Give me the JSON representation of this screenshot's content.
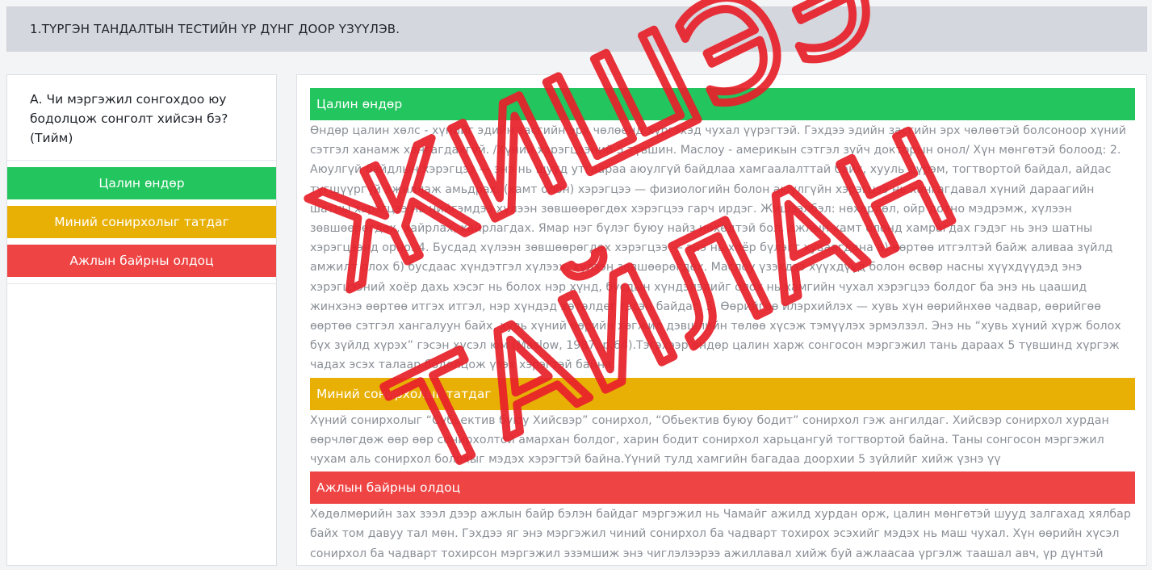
{
  "header": {
    "title": "1.ТҮРГЭН ТАНДАЛТЫН ТЕСТИЙН ҮР ДҮНГ ДООР ҮЗҮҮЛЭВ."
  },
  "question": {
    "text": "А. Чи мэргэжил сонгохдоо юу бодолцож сонголт хийсэн бэ? (Тийм)"
  },
  "options": [
    {
      "label": "Цалин өндөр",
      "color": "#22c55e"
    },
    {
      "label": "Миний сонирхолыг татдаг",
      "color": "#e8b005"
    },
    {
      "label": "Ажлын байрны олдоц",
      "color": "#ef4444"
    }
  ],
  "sections": [
    {
      "title": "Цалин өндөр",
      "color": "#22c55e",
      "text": "Өндөр цалин хөлс - хүнийг эдийн засгийн эрх чөлөөнд хүргэхэд чухал үүрэгтэй. Гэхдээ эдийн засгийн эрх чөлөөтэй болсоноор хүний сэтгэл ханамж хангагдахгүй. /Хүний хэрэгцээний 5 түвшин. Маслоу - америкын сэтгэл зүйч докторын онол/ Хүн мөнгөтэй болоод: 2. Аюулгүй байдлын хэрэгцээ — энэ нь шууд утгаараа аюулгүй байдлаа хамгаалалттай байх, хууль дүрэм, тогтвортой байдал, айдас түгшүүргүй ажиллаж амьдрах. (хамт олон) хэрэгцээ — физиологийн болон аюулгүйн хэрэгцээ нь хангагдавал хүний дараагийн шатны хэрэгцээ нь нийгэмдээ хүлээн зөвшөөрөгдөх хэрэгцээ гарч ирдэг. Жишээлбэл: нөхөрлөл, ойр дотно мэдрэмж, хүлээн зөвшөөрөгдөх, хайрлах, хайрлагдах. Ямар нэг бүлэг буюу найз нөхөдтэй бол, ажлын хамт олонд хамрагдах гэдэг нь энэ шатны хэрэгцээнд орно. 4. Бусдад хүлээн зөвшөөрөгдөх хэрэгцээ — энэ нь хоёр бүлэгт хуваагдана а) өөртөө итгэлтэй байж аливаа зүйлд амжилт олох б) бусдаас хүндэтгэл хүлээх, хүлээн зөвшөөрөгдөх. Маслоу үзэхдээ хүүхдүүд болон өсвөр насны хүүхдүүдэд энэ хэрэгцээний хоёр дахь хэсэг нь болох нэр хүнд, бусдын хүндэлэлийг олох нь хамгийн чухал хэрэгцээ болдог ба энэ нь цаашид жинхэнэ өөртөө итгэх итгэл, нэр хүндэд хөтөлдөг гэсэн байдаг. 5. Өөрийгөө илэрхийлэх — хувь хүн өөрийнхөө чадвар, өөрийгөө өөртөө сэтгэл хангалуун байх, хувь хүний өөрийн хөгжил дэвшлийн төлөө хүсэж тэмүүлэх эрмэлзэл. Энэ нь “хувь хүний хүрж болох бүх зүйлд хүрэх” гэсэн хүсэл юм (Maslow, 1987, p.64).Тэгэхээр өндөр цалин харж сонгосон мэргэжил тань дараах 5 түвшинд хүргэж чадах эсэх талаар бодолцож үзэх хэрэгтэй байна."
    },
    {
      "title": "Миний сонирхолыг татдаг",
      "color": "#e8b005",
      "text": "Хүний сонирхолыг “Субьектив буюу Хийсвэр” сонирхол, “Обьектив буюу бодит” сонирхол гэж ангилдаг. Хийсвэр сонирхол хурдан өөрчлөгдөж өөр өөр сонирхолтой амархан болдог, харин бодит сонирхол харьцангуй тогтвортой байна. Таны сонгосон мэргэжил чухам аль сонирхол болохыг мэдэх хэрэгтэй байна.Үүний тулд хамгийн багадаа доорхии 5 зүйлийг хийж үзнэ үү"
    },
    {
      "title": "Ажлын байрны олдоц",
      "color": "#ef4444",
      "text": "Хөдөлмөрийн зах зээл дээр ажлын байр бэлэн байдаг мэргэжил нь Чамайг ажилд хурдан орж, цалин мөнгөтэй шууд залгахад хялбар байх том давуу тал мөн. Гэхдээ яг энэ мэргэжил чиний сонирхол ба чадварт тохирох эсэхийг мэдэх нь маш чухал. Хүн өөрийн хүсэл сонирхол ба чадварт тохирсон мэргэжил эзэмшиж энэ чиглэлээрээ ажиллавал хийж буй ажлаасаа үргэлж таашал авч, үр дүнтэй ажиллаж, амжилтад хүрэх үндсэн нөхцөл бүрдэнэ. Энэ бол мэргэжил сонголтын “Алтан дүрэм”"
    }
  ],
  "stamp": {
    "line1": "ЖИШЭЭ",
    "line2": "ТАЙЛАН",
    "color": "#e8202a"
  }
}
